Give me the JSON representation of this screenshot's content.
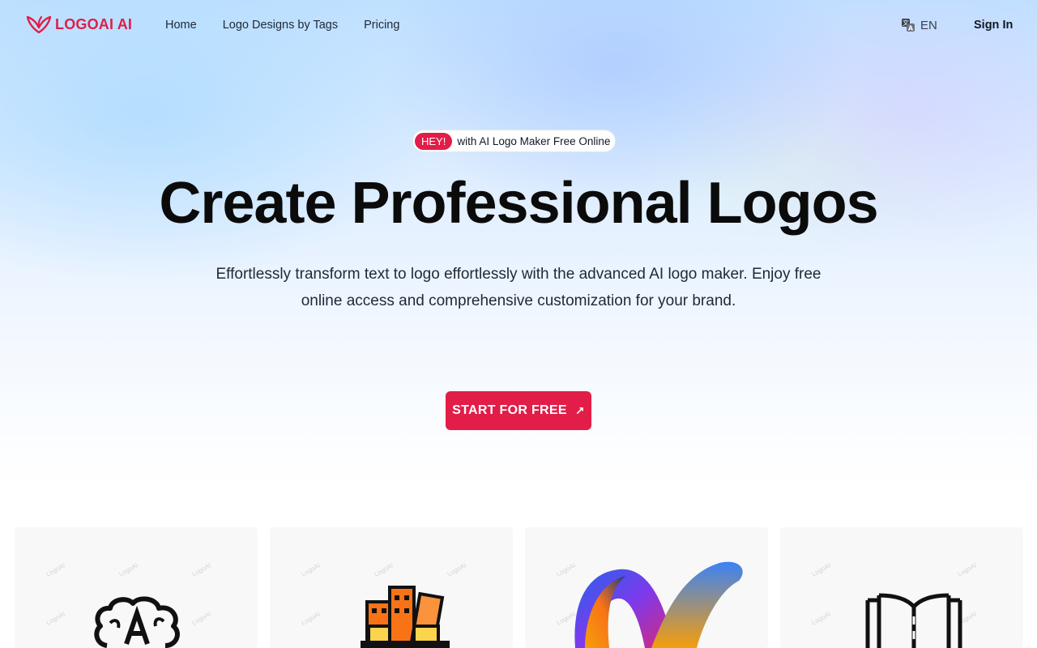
{
  "brand": {
    "name": "LOGOAI AI",
    "color": "#e11d48"
  },
  "nav": {
    "items": [
      "Home",
      "Logo Designs by Tags",
      "Pricing"
    ]
  },
  "header": {
    "language": "EN",
    "signin": "Sign In"
  },
  "hero": {
    "badge_pill": "HEY!",
    "badge_text": "with AI Logo Maker Free Online",
    "title": "Create Professional Logos",
    "subtitle": "Effortlessly transform text to logo effortlessly with the advanced AI logo maker. Enjoy free online access and comprehensive customization for your brand.",
    "cta": "START FOR FREE"
  },
  "gallery": {
    "watermark": "LogoAI",
    "items": [
      "brain-letter-a-logo",
      "buildings-logo",
      "letter-n-gradient-logo",
      "open-book-logo"
    ]
  },
  "icons": [
    "language-icon",
    "arrow-up-right-icon"
  ]
}
